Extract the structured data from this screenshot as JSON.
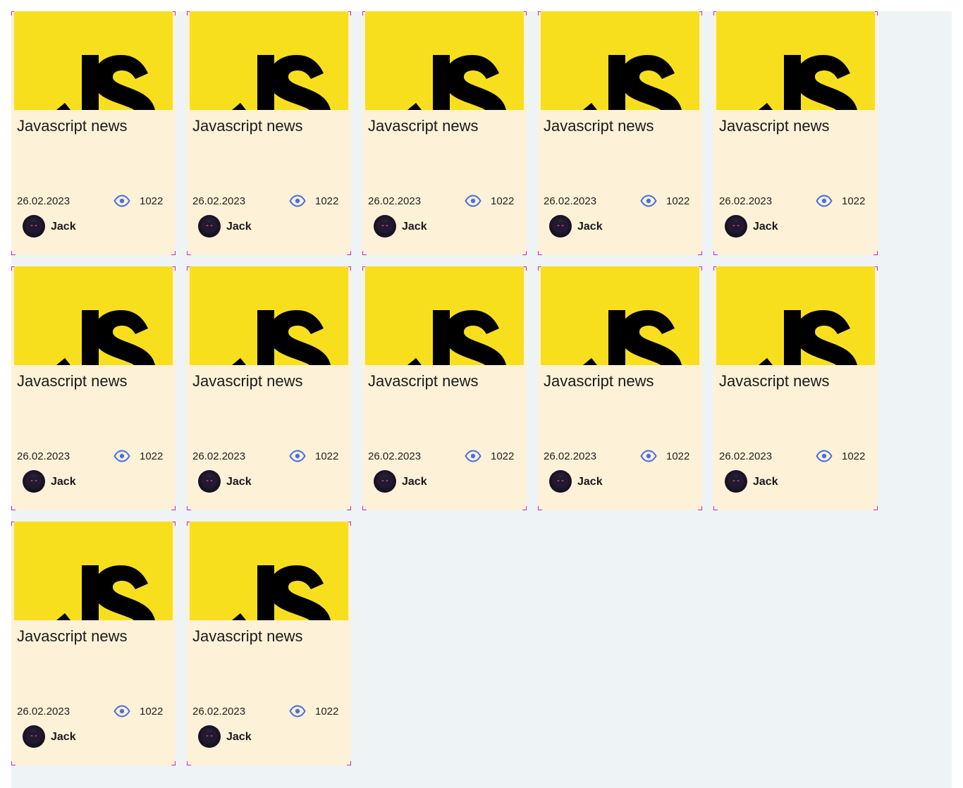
{
  "colors": {
    "page_background": "#eef3f6",
    "card_background": "#fdf2d8",
    "thumbnail_yellow": "#f7df1e",
    "eye_icon": "#4a6fe0"
  },
  "cards": [
    {
      "title": "Javascript news",
      "date": "26.02.2023",
      "views": "1022",
      "author": "Jack",
      "thumbnail_icon": "js-logo",
      "views_icon": "eye-icon"
    },
    {
      "title": "Javascript news",
      "date": "26.02.2023",
      "views": "1022",
      "author": "Jack",
      "thumbnail_icon": "js-logo",
      "views_icon": "eye-icon"
    },
    {
      "title": "Javascript news",
      "date": "26.02.2023",
      "views": "1022",
      "author": "Jack",
      "thumbnail_icon": "js-logo",
      "views_icon": "eye-icon"
    },
    {
      "title": "Javascript news",
      "date": "26.02.2023",
      "views": "1022",
      "author": "Jack",
      "thumbnail_icon": "js-logo",
      "views_icon": "eye-icon"
    },
    {
      "title": "Javascript news",
      "date": "26.02.2023",
      "views": "1022",
      "author": "Jack",
      "thumbnail_icon": "js-logo",
      "views_icon": "eye-icon"
    },
    {
      "title": "Javascript news",
      "date": "26.02.2023",
      "views": "1022",
      "author": "Jack",
      "thumbnail_icon": "js-logo",
      "views_icon": "eye-icon"
    },
    {
      "title": "Javascript news",
      "date": "26.02.2023",
      "views": "1022",
      "author": "Jack",
      "thumbnail_icon": "js-logo",
      "views_icon": "eye-icon"
    },
    {
      "title": "Javascript news",
      "date": "26.02.2023",
      "views": "1022",
      "author": "Jack",
      "thumbnail_icon": "js-logo",
      "views_icon": "eye-icon"
    },
    {
      "title": "Javascript news",
      "date": "26.02.2023",
      "views": "1022",
      "author": "Jack",
      "thumbnail_icon": "js-logo",
      "views_icon": "eye-icon"
    },
    {
      "title": "Javascript news",
      "date": "26.02.2023",
      "views": "1022",
      "author": "Jack",
      "thumbnail_icon": "js-logo",
      "views_icon": "eye-icon"
    },
    {
      "title": "Javascript news",
      "date": "26.02.2023",
      "views": "1022",
      "author": "Jack",
      "thumbnail_icon": "js-logo",
      "views_icon": "eye-icon"
    },
    {
      "title": "Javascript news",
      "date": "26.02.2023",
      "views": "1022",
      "author": "Jack",
      "thumbnail_icon": "js-logo",
      "views_icon": "eye-icon"
    }
  ]
}
